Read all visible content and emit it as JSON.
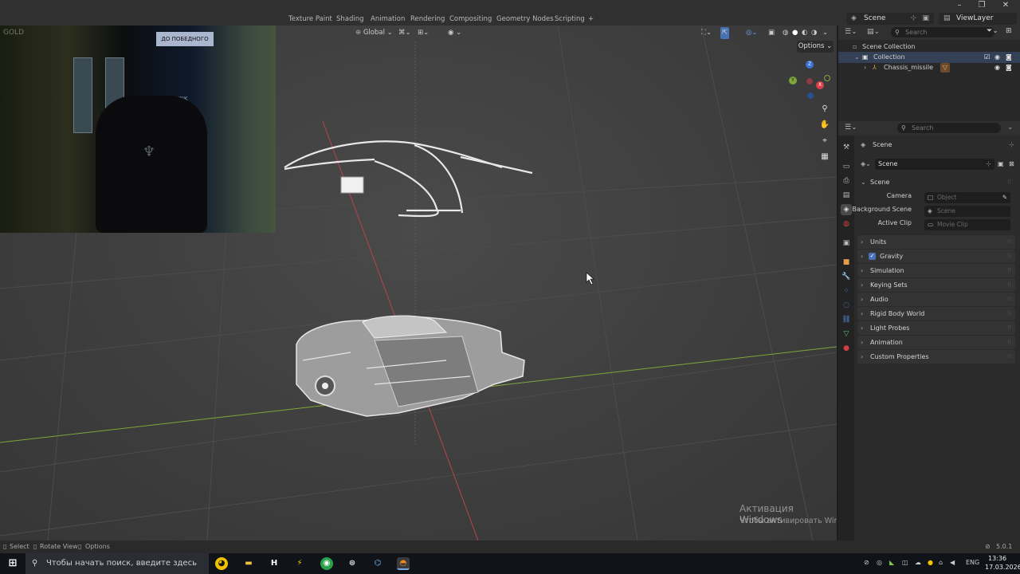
{
  "topbar": {
    "workspace_tabs": [
      "Texture Paint",
      "Shading",
      "Animation",
      "Rendering",
      "Compositing",
      "Geometry Nodes",
      "Scripting"
    ],
    "add_tab": "+",
    "scene": "Scene",
    "view_layer": "ViewLayer"
  },
  "viewport": {
    "transform_orientation": "Global",
    "options_label": "Options",
    "gizmo_axes": {
      "x": "X",
      "y": "Y",
      "z": "Z"
    }
  },
  "webcam": {
    "sign_text": "ДО ПОБЕДНОГО",
    "corner_text": "GOLD",
    "poster_text": "THINK"
  },
  "watermark": {
    "line1": "Активация Windows",
    "line2": "Чтобы активировать Windows, перейдите в раздел \"Параметры\"."
  },
  "statusbar": {
    "select": "Select",
    "rotate_view": "Rotate View",
    "options": "Options",
    "version": "5.0.1"
  },
  "outliner": {
    "search_placeholder": "Search",
    "scene_collection": "Scene Collection",
    "collection": "Collection",
    "object": "Chassis_missile"
  },
  "properties": {
    "search_placeholder": "Search",
    "header_scene": "Scene",
    "scene_name": "Scene",
    "panel_scene": "Scene",
    "camera_label": "Camera",
    "camera_placeholder": "Object",
    "background_label": "Background Scene",
    "background_placeholder": "Scene",
    "clip_label": "Active Clip",
    "clip_placeholder": "Movie Clip",
    "panels": [
      "Units",
      "Gravity",
      "Simulation",
      "Keying Sets",
      "Audio",
      "Rigid Body World",
      "Light Probes",
      "Animation",
      "Custom Properties"
    ],
    "gravity_checked": true
  },
  "taskbar": {
    "search_placeholder": "Чтобы начать поиск, введите здесь запрос",
    "language": "ENG",
    "time": "13:36",
    "date": "17.03.2026"
  },
  "colors": {
    "accent_blue": "#4772b3",
    "axis_red": "#c0444a",
    "axis_green": "#7ea63a",
    "panel_bg": "#2b2b2b"
  }
}
